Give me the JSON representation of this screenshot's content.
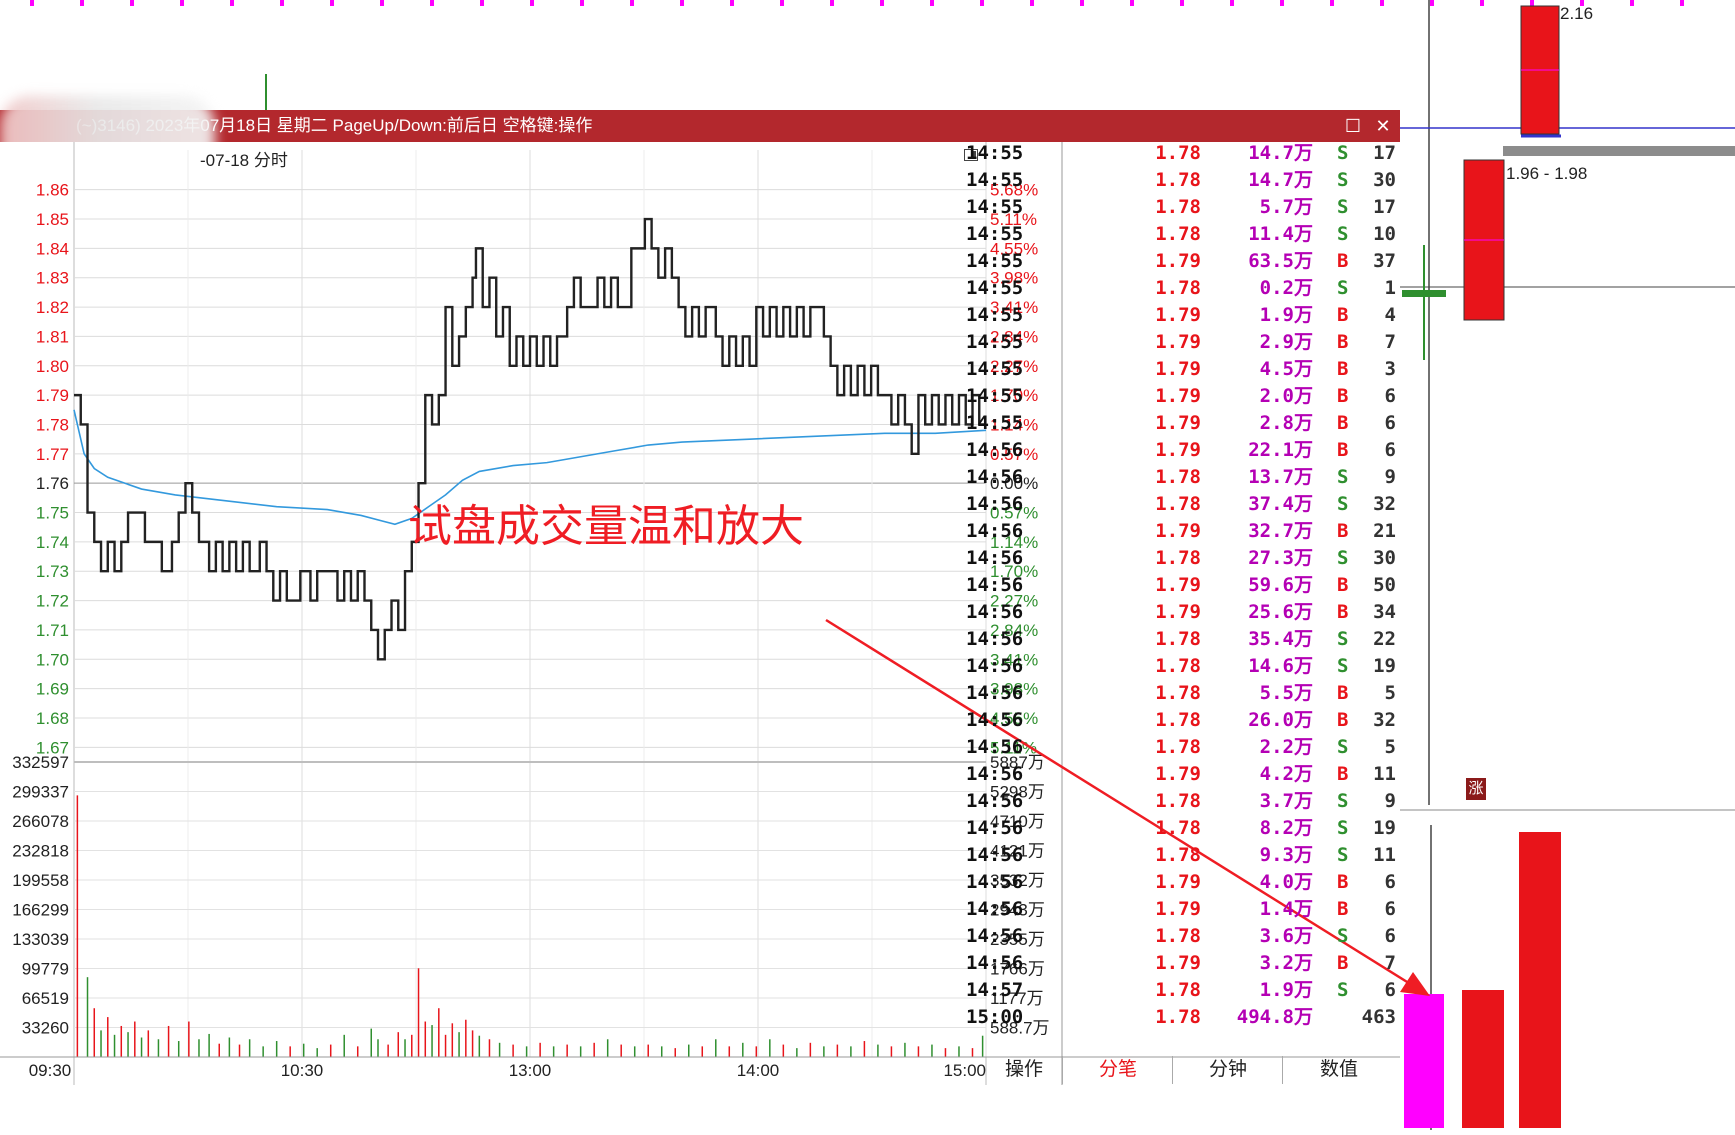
{
  "window": {
    "title": "(~)3146) 2023年07月18日 星期二 PageUp/Down:前后日 空格键:操作",
    "chart_title": "-07-18 分时",
    "maximize_glyph": "☐",
    "close_glyph": "✕"
  },
  "annotation": "试盘成交量温和放大",
  "background_labels": {
    "top_price": "2.16",
    "range_price": "1.96 - 1.98",
    "flag_char": "涨",
    "corner_count": "1"
  },
  "colors": {
    "up": "#e8141a",
    "down": "#2f8f2f",
    "avg_line": "#3399dd",
    "price_line": "#222222",
    "magenta": "#ff00ff",
    "title_bar": "#b3282d",
    "tick_vol": "#b400b4"
  },
  "chart_data": {
    "type": "line",
    "price_axis": {
      "ticks": [
        "1.86",
        "1.85",
        "1.84",
        "1.83",
        "1.82",
        "1.81",
        "1.80",
        "1.79",
        "1.78",
        "1.77",
        "1.76",
        "1.75",
        "1.74",
        "1.73",
        "1.72",
        "1.71",
        "1.70",
        "1.69",
        "1.68",
        "1.67"
      ],
      "ylim": [
        1.665,
        1.865
      ],
      "prev_close": 1.76
    },
    "pct_axis": [
      "5.68%",
      "5.11%",
      "4.55%",
      "3.98%",
      "3.41%",
      "2.84%",
      "2.27%",
      "1.70%",
      "1.14%",
      "0.57%",
      "0.00%",
      "0.57%",
      "1.14%",
      "1.70%",
      "2.27%",
      "2.84%",
      "3.41%",
      "3.98%",
      "4.55%",
      "5.11%"
    ],
    "volume_axis": {
      "left": [
        "332597",
        "299337",
        "266078",
        "232818",
        "199558",
        "166299",
        "133039",
        "99779",
        "66519",
        "33260"
      ],
      "right": [
        "5887万",
        "5298万",
        "4710万",
        "4121万",
        "3532万",
        "2943万",
        "2355万",
        "1766万",
        "1177万",
        "588.7万"
      ],
      "ymax": 332597
    },
    "x_labels": [
      "09:30",
      "10:30",
      "13:00",
      "14:00",
      "15:00"
    ],
    "price_series": [
      [
        0,
        1.79
      ],
      [
        2,
        1.78
      ],
      [
        4,
        1.75
      ],
      [
        6,
        1.74
      ],
      [
        8,
        1.73
      ],
      [
        10,
        1.74
      ],
      [
        12,
        1.73
      ],
      [
        14,
        1.74
      ],
      [
        16,
        1.75
      ],
      [
        18,
        1.75
      ],
      [
        21,
        1.74
      ],
      [
        24,
        1.74
      ],
      [
        26,
        1.73
      ],
      [
        29,
        1.74
      ],
      [
        31,
        1.75
      ],
      [
        33,
        1.76
      ],
      [
        35,
        1.75
      ],
      [
        37,
        1.74
      ],
      [
        40,
        1.73
      ],
      [
        42,
        1.74
      ],
      [
        44,
        1.73
      ],
      [
        46,
        1.74
      ],
      [
        48,
        1.73
      ],
      [
        50,
        1.74
      ],
      [
        52,
        1.73
      ],
      [
        55,
        1.74
      ],
      [
        57,
        1.73
      ],
      [
        59,
        1.72
      ],
      [
        61,
        1.73
      ],
      [
        63,
        1.72
      ],
      [
        65,
        1.72
      ],
      [
        67,
        1.73
      ],
      [
        70,
        1.72
      ],
      [
        72,
        1.73
      ],
      [
        74,
        1.73
      ],
      [
        76,
        1.73
      ],
      [
        78,
        1.72
      ],
      [
        80,
        1.73
      ],
      [
        82,
        1.72
      ],
      [
        84,
        1.73
      ],
      [
        86,
        1.72
      ],
      [
        88,
        1.71
      ],
      [
        90,
        1.7
      ],
      [
        92,
        1.71
      ],
      [
        94,
        1.72
      ],
      [
        96,
        1.71
      ],
      [
        98,
        1.73
      ],
      [
        100,
        1.74
      ],
      [
        102,
        1.76
      ],
      [
        104,
        1.79
      ],
      [
        106,
        1.78
      ],
      [
        108,
        1.79
      ],
      [
        110,
        1.82
      ],
      [
        112,
        1.8
      ],
      [
        114,
        1.81
      ],
      [
        116,
        1.82
      ],
      [
        118,
        1.83
      ],
      [
        119,
        1.84
      ],
      [
        121,
        1.82
      ],
      [
        123,
        1.83
      ],
      [
        125,
        1.81
      ],
      [
        127,
        1.82
      ],
      [
        129,
        1.8
      ],
      [
        131,
        1.81
      ],
      [
        133,
        1.8
      ],
      [
        135,
        1.81
      ],
      [
        137,
        1.8
      ],
      [
        139,
        1.81
      ],
      [
        141,
        1.8
      ],
      [
        143,
        1.81
      ],
      [
        146,
        1.82
      ],
      [
        148,
        1.83
      ],
      [
        150,
        1.82
      ],
      [
        152,
        1.82
      ],
      [
        155,
        1.83
      ],
      [
        157,
        1.82
      ],
      [
        159,
        1.83
      ],
      [
        161,
        1.82
      ],
      [
        163,
        1.82
      ],
      [
        165,
        1.84
      ],
      [
        167,
        1.84
      ],
      [
        169,
        1.85
      ],
      [
        171,
        1.84
      ],
      [
        173,
        1.83
      ],
      [
        175,
        1.84
      ],
      [
        177,
        1.83
      ],
      [
        179,
        1.82
      ],
      [
        181,
        1.81
      ],
      [
        183,
        1.82
      ],
      [
        185,
        1.81
      ],
      [
        187,
        1.82
      ],
      [
        190,
        1.81
      ],
      [
        192,
        1.8
      ],
      [
        194,
        1.81
      ],
      [
        196,
        1.8
      ],
      [
        198,
        1.81
      ],
      [
        200,
        1.8
      ],
      [
        202,
        1.82
      ],
      [
        204,
        1.81
      ],
      [
        206,
        1.82
      ],
      [
        208,
        1.81
      ],
      [
        210,
        1.82
      ],
      [
        212,
        1.81
      ],
      [
        214,
        1.82
      ],
      [
        216,
        1.81
      ],
      [
        218,
        1.82
      ],
      [
        220,
        1.82
      ],
      [
        222,
        1.81
      ],
      [
        224,
        1.8
      ],
      [
        226,
        1.79
      ],
      [
        228,
        1.8
      ],
      [
        230,
        1.79
      ],
      [
        232,
        1.8
      ],
      [
        234,
        1.79
      ],
      [
        236,
        1.8
      ],
      [
        238,
        1.79
      ],
      [
        240,
        1.79
      ],
      [
        242,
        1.78
      ],
      [
        244,
        1.79
      ],
      [
        246,
        1.78
      ],
      [
        248,
        1.77
      ],
      [
        250,
        1.79
      ],
      [
        252,
        1.78
      ],
      [
        254,
        1.79
      ],
      [
        256,
        1.78
      ],
      [
        258,
        1.79
      ],
      [
        260,
        1.78
      ],
      [
        262,
        1.79
      ],
      [
        264,
        1.78
      ],
      [
        266,
        1.79
      ],
      [
        268,
        1.78
      ],
      [
        270,
        1.78
      ]
    ],
    "avg_series": [
      [
        0,
        1.785
      ],
      [
        3,
        1.77
      ],
      [
        6,
        1.765
      ],
      [
        10,
        1.762
      ],
      [
        15,
        1.76
      ],
      [
        20,
        1.758
      ],
      [
        30,
        1.756
      ],
      [
        45,
        1.754
      ],
      [
        60,
        1.752
      ],
      [
        75,
        1.751
      ],
      [
        85,
        1.749
      ],
      [
        95,
        1.746
      ],
      [
        100,
        1.748
      ],
      [
        105,
        1.752
      ],
      [
        110,
        1.756
      ],
      [
        115,
        1.761
      ],
      [
        120,
        1.764
      ],
      [
        130,
        1.766
      ],
      [
        140,
        1.767
      ],
      [
        150,
        1.769
      ],
      [
        160,
        1.771
      ],
      [
        170,
        1.773
      ],
      [
        180,
        1.774
      ],
      [
        200,
        1.775
      ],
      [
        220,
        1.776
      ],
      [
        240,
        1.777
      ],
      [
        255,
        1.777
      ],
      [
        270,
        1.778
      ]
    ],
    "volume_bars": [
      [
        1,
        295000,
        "up"
      ],
      [
        4,
        90000,
        "down"
      ],
      [
        6,
        55000,
        "up"
      ],
      [
        8,
        30000,
        "down"
      ],
      [
        10,
        45000,
        "up"
      ],
      [
        12,
        25000,
        "down"
      ],
      [
        14,
        35000,
        "up"
      ],
      [
        16,
        28000,
        "down"
      ],
      [
        18,
        40000,
        "up"
      ],
      [
        20,
        22000,
        "down"
      ],
      [
        22,
        30000,
        "up"
      ],
      [
        25,
        20000,
        "down"
      ],
      [
        28,
        35000,
        "up"
      ],
      [
        31,
        18000,
        "down"
      ],
      [
        34,
        40000,
        "up"
      ],
      [
        37,
        20000,
        "down"
      ],
      [
        40,
        26000,
        "down"
      ],
      [
        43,
        15000,
        "up"
      ],
      [
        46,
        22000,
        "down"
      ],
      [
        49,
        14000,
        "up"
      ],
      [
        52,
        20000,
        "down"
      ],
      [
        56,
        12000,
        "down"
      ],
      [
        60,
        18000,
        "down"
      ],
      [
        64,
        12000,
        "up"
      ],
      [
        68,
        15000,
        "down"
      ],
      [
        72,
        10000,
        "down"
      ],
      [
        76,
        14000,
        "up"
      ],
      [
        80,
        25000,
        "down"
      ],
      [
        84,
        12000,
        "up"
      ],
      [
        88,
        32000,
        "down"
      ],
      [
        90,
        20000,
        "down"
      ],
      [
        93,
        14000,
        "up"
      ],
      [
        96,
        28000,
        "up"
      ],
      [
        98,
        20000,
        "down"
      ],
      [
        100,
        25000,
        "up"
      ],
      [
        102,
        100000,
        "up"
      ],
      [
        104,
        40000,
        "up"
      ],
      [
        106,
        36000,
        "down"
      ],
      [
        108,
        55000,
        "up"
      ],
      [
        110,
        25000,
        "up"
      ],
      [
        112,
        38000,
        "up"
      ],
      [
        114,
        28000,
        "down"
      ],
      [
        116,
        42000,
        "up"
      ],
      [
        118,
        30000,
        "up"
      ],
      [
        120,
        24000,
        "down"
      ],
      [
        123,
        20000,
        "up"
      ],
      [
        126,
        16000,
        "down"
      ],
      [
        130,
        14000,
        "up"
      ],
      [
        134,
        12000,
        "down"
      ],
      [
        138,
        16000,
        "up"
      ],
      [
        142,
        12000,
        "down"
      ],
      [
        146,
        14000,
        "up"
      ],
      [
        150,
        12000,
        "down"
      ],
      [
        154,
        16000,
        "up"
      ],
      [
        158,
        20000,
        "down"
      ],
      [
        162,
        14000,
        "up"
      ],
      [
        166,
        12000,
        "down"
      ],
      [
        170,
        14000,
        "up"
      ],
      [
        174,
        12000,
        "down"
      ],
      [
        178,
        10000,
        "up"
      ],
      [
        182,
        14000,
        "down"
      ],
      [
        186,
        12000,
        "up"
      ],
      [
        190,
        20000,
        "down"
      ],
      [
        194,
        12000,
        "up"
      ],
      [
        198,
        16000,
        "down"
      ],
      [
        202,
        12000,
        "up"
      ],
      [
        206,
        20000,
        "down"
      ],
      [
        210,
        14000,
        "up"
      ],
      [
        214,
        10000,
        "down"
      ],
      [
        218,
        16000,
        "up"
      ],
      [
        222,
        12000,
        "down"
      ],
      [
        226,
        14000,
        "up"
      ],
      [
        230,
        12000,
        "down"
      ],
      [
        234,
        18000,
        "up"
      ],
      [
        238,
        14000,
        "down"
      ],
      [
        242,
        12000,
        "up"
      ],
      [
        246,
        16000,
        "down"
      ],
      [
        250,
        12000,
        "up"
      ],
      [
        254,
        14000,
        "down"
      ],
      [
        258,
        10000,
        "up"
      ],
      [
        262,
        12000,
        "down"
      ],
      [
        266,
        10000,
        "up"
      ],
      [
        269,
        24000,
        "down"
      ]
    ]
  },
  "ticks": [
    {
      "time": "14:55",
      "price": "1.78",
      "vol": "14.7万",
      "side": "S",
      "count": "17"
    },
    {
      "time": "14:55",
      "price": "1.78",
      "vol": "14.7万",
      "side": "S",
      "count": "30"
    },
    {
      "time": "14:55",
      "price": "1.78",
      "vol": "5.7万",
      "side": "S",
      "count": "17"
    },
    {
      "time": "14:55",
      "price": "1.78",
      "vol": "11.4万",
      "side": "S",
      "count": "10"
    },
    {
      "time": "14:55",
      "price": "1.79",
      "vol": "63.5万",
      "side": "B",
      "count": "37"
    },
    {
      "time": "14:55",
      "price": "1.78",
      "vol": "0.2万",
      "side": "S",
      "count": "1"
    },
    {
      "time": "14:55",
      "price": "1.79",
      "vol": "1.9万",
      "side": "B",
      "count": "4"
    },
    {
      "time": "14:55",
      "price": "1.79",
      "vol": "2.9万",
      "side": "B",
      "count": "7"
    },
    {
      "time": "14:55",
      "price": "1.79",
      "vol": "4.5万",
      "side": "B",
      "count": "3"
    },
    {
      "time": "14:55",
      "price": "1.79",
      "vol": "2.0万",
      "side": "B",
      "count": "6"
    },
    {
      "time": "14:55",
      "price": "1.79",
      "vol": "2.8万",
      "side": "B",
      "count": "6"
    },
    {
      "time": "14:56",
      "price": "1.79",
      "vol": "22.1万",
      "side": "B",
      "count": "6"
    },
    {
      "time": "14:56",
      "price": "1.78",
      "vol": "13.7万",
      "side": "S",
      "count": "9"
    },
    {
      "time": "14:56",
      "price": "1.78",
      "vol": "37.4万",
      "side": "S",
      "count": "32"
    },
    {
      "time": "14:56",
      "price": "1.79",
      "vol": "32.7万",
      "side": "B",
      "count": "21"
    },
    {
      "time": "14:56",
      "price": "1.78",
      "vol": "27.3万",
      "side": "S",
      "count": "30"
    },
    {
      "time": "14:56",
      "price": "1.79",
      "vol": "59.6万",
      "side": "B",
      "count": "50"
    },
    {
      "time": "14:56",
      "price": "1.79",
      "vol": "25.6万",
      "side": "B",
      "count": "34"
    },
    {
      "time": "14:56",
      "price": "1.78",
      "vol": "35.4万",
      "side": "S",
      "count": "22"
    },
    {
      "time": "14:56",
      "price": "1.78",
      "vol": "14.6万",
      "side": "S",
      "count": "19"
    },
    {
      "time": "14:56",
      "price": "1.78",
      "vol": "5.5万",
      "side": "B",
      "count": "5"
    },
    {
      "time": "14:56",
      "price": "1.78",
      "vol": "26.0万",
      "side": "B",
      "count": "32"
    },
    {
      "time": "14:56",
      "price": "1.78",
      "vol": "2.2万",
      "side": "S",
      "count": "5"
    },
    {
      "time": "14:56",
      "price": "1.79",
      "vol": "4.2万",
      "side": "B",
      "count": "11"
    },
    {
      "time": "14:56",
      "price": "1.78",
      "vol": "3.7万",
      "side": "S",
      "count": "9"
    },
    {
      "time": "14:56",
      "price": "1.78",
      "vol": "8.2万",
      "side": "S",
      "count": "19"
    },
    {
      "time": "14:56",
      "price": "1.78",
      "vol": "9.3万",
      "side": "S",
      "count": "11"
    },
    {
      "time": "14:56",
      "price": "1.79",
      "vol": "4.0万",
      "side": "B",
      "count": "6"
    },
    {
      "time": "14:56",
      "price": "1.79",
      "vol": "1.4万",
      "side": "B",
      "count": "6"
    },
    {
      "time": "14:56",
      "price": "1.78",
      "vol": "3.6万",
      "side": "S",
      "count": "6"
    },
    {
      "time": "14:56",
      "price": "1.79",
      "vol": "3.2万",
      "side": "B",
      "count": "7"
    },
    {
      "time": "14:57",
      "price": "1.78",
      "vol": "1.9万",
      "side": "S",
      "count": "6"
    },
    {
      "time": "15:00",
      "price": "1.78",
      "vol": "494.8万",
      "side": "",
      "count": "463"
    }
  ],
  "tabs": [
    {
      "id": "ops",
      "label": "操作",
      "active": false
    },
    {
      "id": "trades",
      "label": "分笔",
      "active": true
    },
    {
      "id": "minute",
      "label": "分钟",
      "active": false
    },
    {
      "id": "values",
      "label": "数值",
      "active": false
    }
  ]
}
